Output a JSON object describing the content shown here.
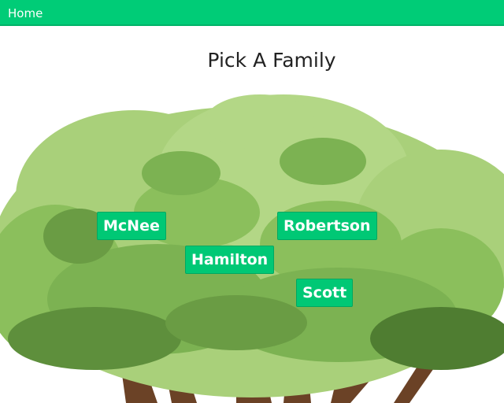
{
  "nav": {
    "home_label": "Home"
  },
  "page": {
    "title": "Pick A Family"
  },
  "families": [
    {
      "id": "mcnee",
      "label": "McNee"
    },
    {
      "id": "robertson",
      "label": "Robertson"
    },
    {
      "id": "hamilton",
      "label": "Hamilton"
    },
    {
      "id": "scott",
      "label": "Scott"
    }
  ],
  "colors": {
    "navbar": "#00cc77",
    "button": "#00c875",
    "tree_light": "#a9d07a",
    "tree_mid": "#8bbf5c",
    "tree_dark": "#5e8f3c",
    "trunk": "#6b4226"
  }
}
